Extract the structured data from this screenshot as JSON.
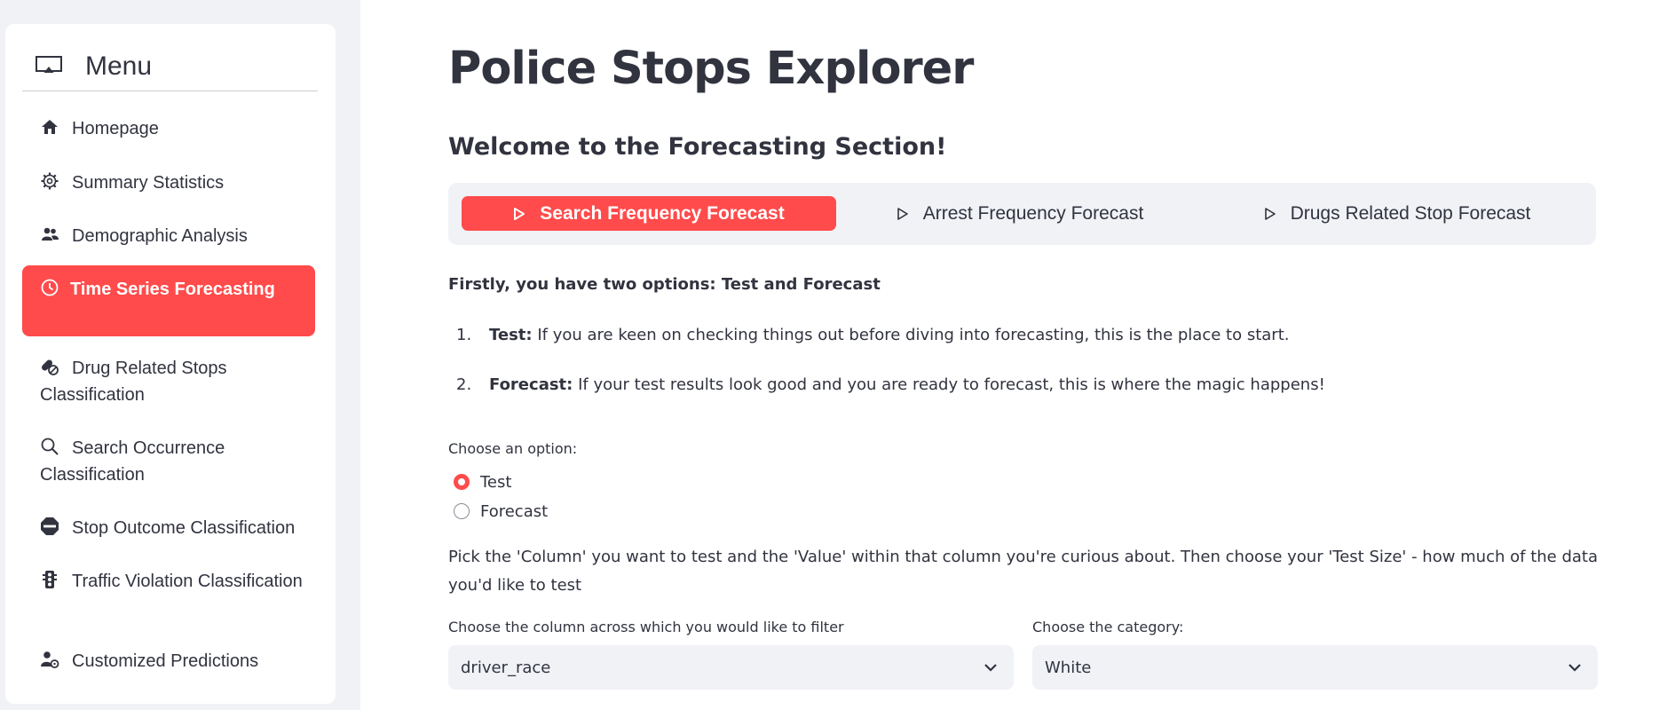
{
  "sidebar": {
    "menu_title": "Menu",
    "items": [
      {
        "label": "Homepage",
        "icon": "house-icon"
      },
      {
        "label": "Summary Statistics",
        "icon": "gear-icon"
      },
      {
        "label": "Demographic Analysis",
        "icon": "people-icon"
      },
      {
        "label": "Time Series Forecasting",
        "icon": "clock-icon",
        "active": true
      },
      {
        "label": "Drug Related Stops Classification",
        "icon": "capsule-icon"
      },
      {
        "label": "Search Occurrence Classification",
        "icon": "search-icon"
      },
      {
        "label": "Stop Outcome Classification",
        "icon": "stop-sign-icon"
      },
      {
        "label": "Traffic Violation Classification",
        "icon": "traffic-light-icon"
      },
      {
        "label": "Customized Predictions",
        "icon": "person-gear-icon"
      }
    ]
  },
  "main": {
    "title": "Police Stops Explorer",
    "subtitle": "Welcome to the Forecasting Section!",
    "tabs": [
      {
        "label": "Search Frequency Forecast",
        "active": true
      },
      {
        "label": "Arrest Frequency Forecast"
      },
      {
        "label": "Drugs Related Stop Forecast"
      }
    ],
    "intro": "Firstly, you have two options: Test and Forecast",
    "list": [
      {
        "num": "1.",
        "term": "Test:",
        "text": " If you are keen on checking things out before diving into forecasting, this is the place to start."
      },
      {
        "num": "2.",
        "term": "Forecast:",
        "text": " If your test results look good and you are ready to forecast, this is where the magic happens!"
      }
    ],
    "radio": {
      "label": "Choose an option:",
      "options": [
        "Test",
        "Forecast"
      ],
      "selected": "Test"
    },
    "instructions": "Pick the 'Column' you want to test and the 'Value' within that column you're curious about. Then choose your 'Test Size' - how much of the data you'd like to test",
    "column_select": {
      "label": "Choose the column across which you would like to filter",
      "value": "driver_race"
    },
    "category_select": {
      "label": "Choose the category:",
      "value": "White"
    }
  },
  "colors": {
    "accent": "#ff4b4b",
    "sidebar_bg": "#f0f2f6",
    "text": "#31333f"
  }
}
